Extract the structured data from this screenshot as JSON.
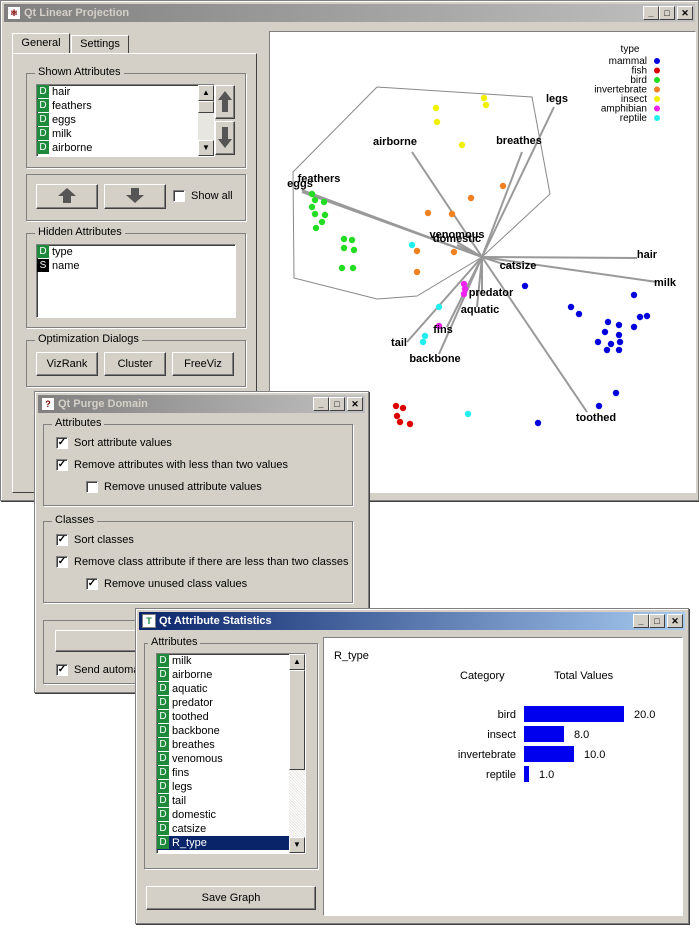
{
  "linear": {
    "title": "Qt Linear Projection",
    "tabs": [
      "General",
      "Settings"
    ],
    "shown_group": "Shown Attributes",
    "shown": [
      "hair",
      "feathers",
      "eggs",
      "milk",
      "airborne"
    ],
    "show_all": "Show all",
    "hidden_group": "Hidden Attributes",
    "hidden": [
      {
        "badge": "D",
        "name": "type"
      },
      {
        "badge": "S",
        "name": "name"
      }
    ],
    "opt_group": "Optimization Dialogs",
    "opt_buttons": [
      "VizRank",
      "Cluster",
      "FreeViz"
    ],
    "legend_title": "type",
    "legend": [
      {
        "name": "mammal",
        "color": "#0000dd"
      },
      {
        "name": "fish",
        "color": "#dd0000"
      },
      {
        "name": "bird",
        "color": "#22dd22"
      },
      {
        "name": "invertebrate",
        "color": "#f08020"
      },
      {
        "name": "insect",
        "color": "#f0f000"
      },
      {
        "name": "amphibian",
        "color": "#ee22ee"
      },
      {
        "name": "reptile",
        "color": "#22eeee"
      }
    ],
    "anchors": [
      "legs",
      "airborne",
      "breathes",
      "feathers",
      "eggs",
      "venomous",
      "domestic",
      "hair",
      "catsize",
      "milk",
      "predator",
      "aquatic",
      "fins",
      "tail",
      "backbone",
      "toothed"
    ]
  },
  "purge": {
    "title": "Qt Purge Domain",
    "attr_group": "Attributes",
    "sort_attr": "Sort attribute values",
    "remove_attr": "Remove attributes with less than two values",
    "remove_unused_attr": "Remove unused attribute values",
    "class_group": "Classes",
    "sort_classes": "Sort classes",
    "remove_class": "Remove class attribute if there are less than two classes",
    "remove_unused_class": "Remove unused class values",
    "send_auto": "Send automa"
  },
  "stats": {
    "title": "Qt Attribute Statistics",
    "attr_group": "Attributes",
    "attributes": [
      "milk",
      "airborne",
      "aquatic",
      "predator",
      "toothed",
      "backbone",
      "breathes",
      "venomous",
      "fins",
      "legs",
      "tail",
      "domestic",
      "catsize",
      "R_type"
    ],
    "selected": "R_type",
    "save": "Save Graph",
    "attr_name": "R_type",
    "col_category": "Category",
    "col_total": "Total Values"
  },
  "chart_data": {
    "type": "bar",
    "title": "R_type",
    "xlabel": "Total Values",
    "ylabel": "Category",
    "categories": [
      "bird",
      "insect",
      "invertebrate",
      "reptile"
    ],
    "values": [
      20.0,
      8.0,
      10.0,
      1.0
    ],
    "value_labels": [
      "20.0",
      "8.0",
      "10.0",
      "1.0"
    ],
    "color": "#0000ee"
  }
}
